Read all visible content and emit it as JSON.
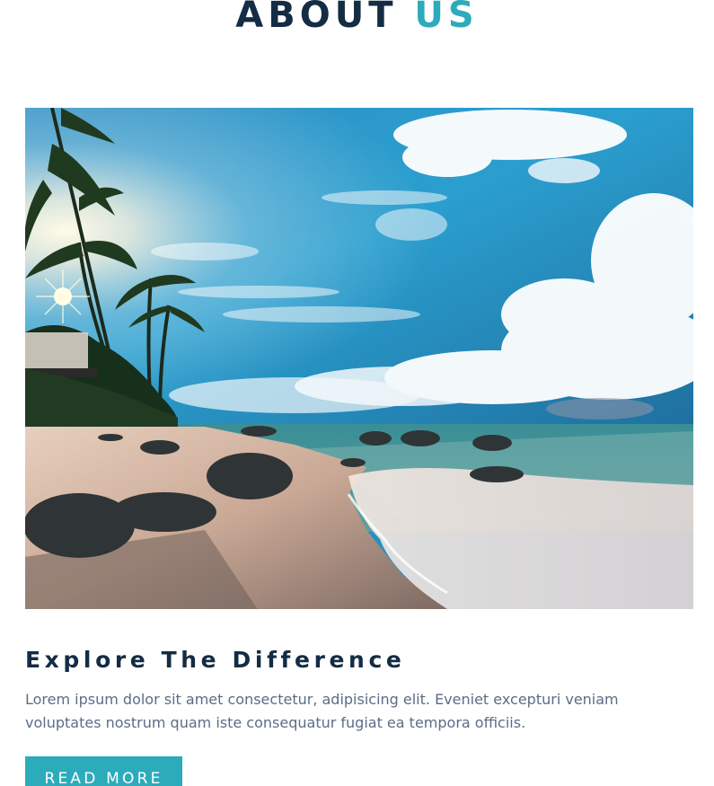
{
  "section": {
    "title_main": "ABOUT",
    "title_accent": "US",
    "accent_color": "#2cabbb",
    "heading_color": "#142c44"
  },
  "hero_image": {
    "subject": "tropical beach with palm trees, rocks, waves and cloudy blue sky"
  },
  "content": {
    "subtitle": "Explore The Difference",
    "body": "Lorem ipsum dolor sit amet consectetur, adipisicing elit. Eveniet excepturi veniam voluptates nostrum quam iste consequatur fugiat ea tempora officiis.",
    "button_label": "READ MORE"
  }
}
